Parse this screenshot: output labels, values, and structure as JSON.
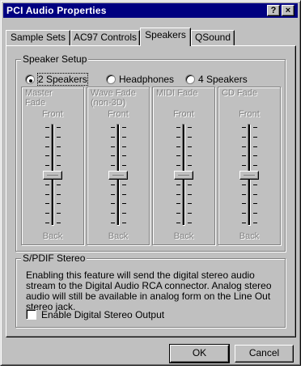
{
  "window": {
    "title": "PCI Audio Properties",
    "help_label": "?",
    "close_label": "×"
  },
  "tabs": [
    {
      "label": "Sample Sets",
      "active": false
    },
    {
      "label": "AC97 Controls",
      "active": false
    },
    {
      "label": "Speakers",
      "active": true
    },
    {
      "label": "QSound",
      "active": false
    }
  ],
  "speaker_setup": {
    "label": "Speaker Setup",
    "options": [
      {
        "label": "2 Speakers",
        "selected": true
      },
      {
        "label": "Headphones",
        "selected": false
      },
      {
        "label": "4 Speakers",
        "selected": false
      }
    ],
    "faders": [
      {
        "title_line1": "Master",
        "title_line2": "Fade",
        "front": "Front",
        "back": "Back",
        "level": 0.5
      },
      {
        "title_line1": "Wave Fade",
        "title_line2": "(non-3D)",
        "front": "Front",
        "back": "Back",
        "level": 0.5
      },
      {
        "title_line1": "MIDI Fade",
        "title_line2": "",
        "front": "Front",
        "back": "Back",
        "level": 0.5
      },
      {
        "title_line1": "CD Fade",
        "title_line2": "",
        "front": "Front",
        "back": "Back",
        "level": 0.5
      }
    ]
  },
  "spdif": {
    "label": "S/PDIF Stereo",
    "description": "Enabling this feature will send the digital stereo audio stream to the Digital Audio RCA connector. Analog stereo audio will still be available in analog form on the Line Out stereo jack.",
    "checkbox_label": "Enable Digital Stereo Output",
    "checked": false
  },
  "buttons": {
    "ok": "OK",
    "cancel": "Cancel"
  }
}
